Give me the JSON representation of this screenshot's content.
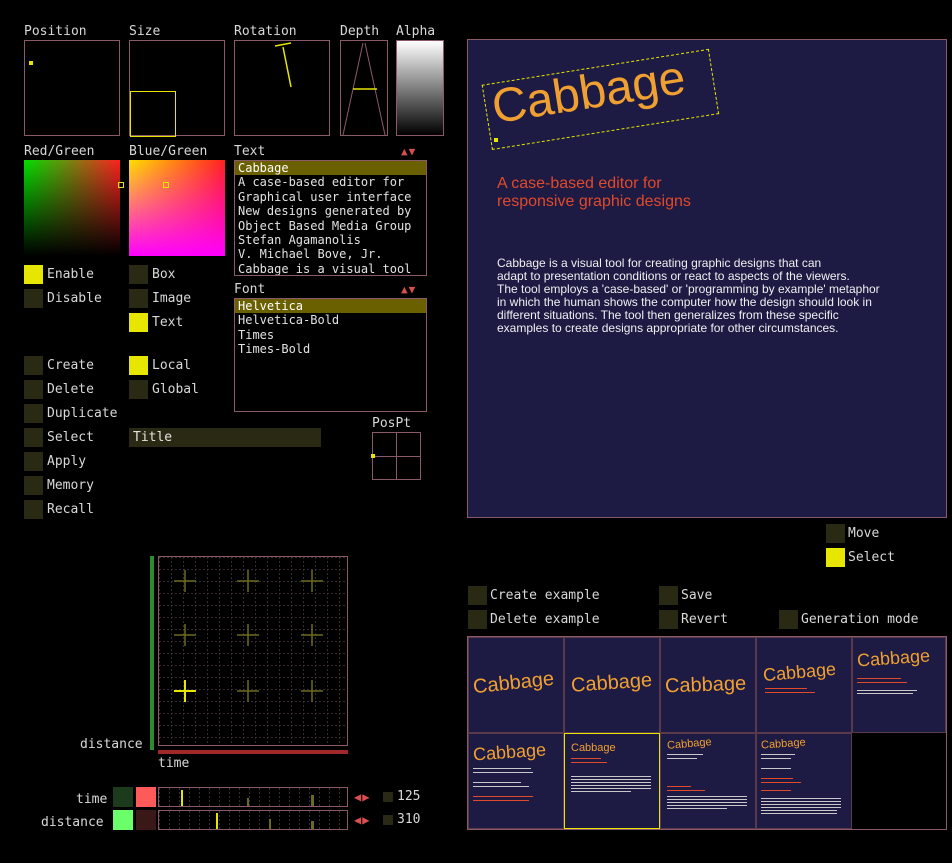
{
  "panels": {
    "position": "Position",
    "size": "Size",
    "rotation": "Rotation",
    "depth": "Depth",
    "alpha": "Alpha",
    "red_green": "Red/Green",
    "blue_green": "Blue/Green",
    "text": "Text",
    "font": "Font",
    "pospt": "PosPt"
  },
  "text_list": [
    "Cabbage",
    "A case-based editor for",
    "Graphical user interface",
    "New designs generated by",
    "Object Based Media Group",
    "Stefan Agamanolis",
    "V. Michael Bove, Jr.",
    "Cabbage is a visual tool"
  ],
  "font_list": [
    "Helvetica",
    "Helvetica-Bold",
    "Times",
    "Times-Bold"
  ],
  "toggles": {
    "enable": "Enable",
    "disable": "Disable",
    "box": "Box",
    "image": "Image",
    "text": "Text"
  },
  "actions": {
    "create": "Create",
    "delete": "Delete",
    "duplicate": "Duplicate",
    "select": "Select",
    "apply": "Apply",
    "memory": "Memory",
    "recall": "Recall",
    "local": "Local",
    "global": "Global"
  },
  "select_value": "Title",
  "graph": {
    "ylabel": "distance",
    "xlabel": "time"
  },
  "sliders": {
    "time_label": "time",
    "distance_label": "distance",
    "time_value": "125",
    "distance_value": "310"
  },
  "canvas": {
    "title": "Cabbage",
    "subtitle1": "A case-based editor for",
    "subtitle2": "responsive graphic designs",
    "body": [
      "Cabbage is a visual tool for creating graphic designs that can",
      "adapt to presentation conditions or react to aspects of the viewers.",
      "The tool employs a 'case-based' or 'programming by example' metaphor",
      "in which the human shows the computer how the design should look in",
      "different situations.  The tool then generalizes from these specific",
      "examples to create designs appropriate for other circumstances."
    ]
  },
  "canvas_modes": {
    "move": "Move",
    "select": "Select"
  },
  "example_buttons": {
    "create_example": "Create example",
    "delete_example": "Delete example",
    "save": "Save",
    "revert": "Revert",
    "generation_mode": "Generation mode"
  },
  "thumbnail_title": "Cabbage",
  "colors": {
    "accent": "#e6e600",
    "frame": "#8a5a6a",
    "canvas_bg": "#1d1a44",
    "title": "#f0a030",
    "subtitle": "#e04a2a"
  }
}
